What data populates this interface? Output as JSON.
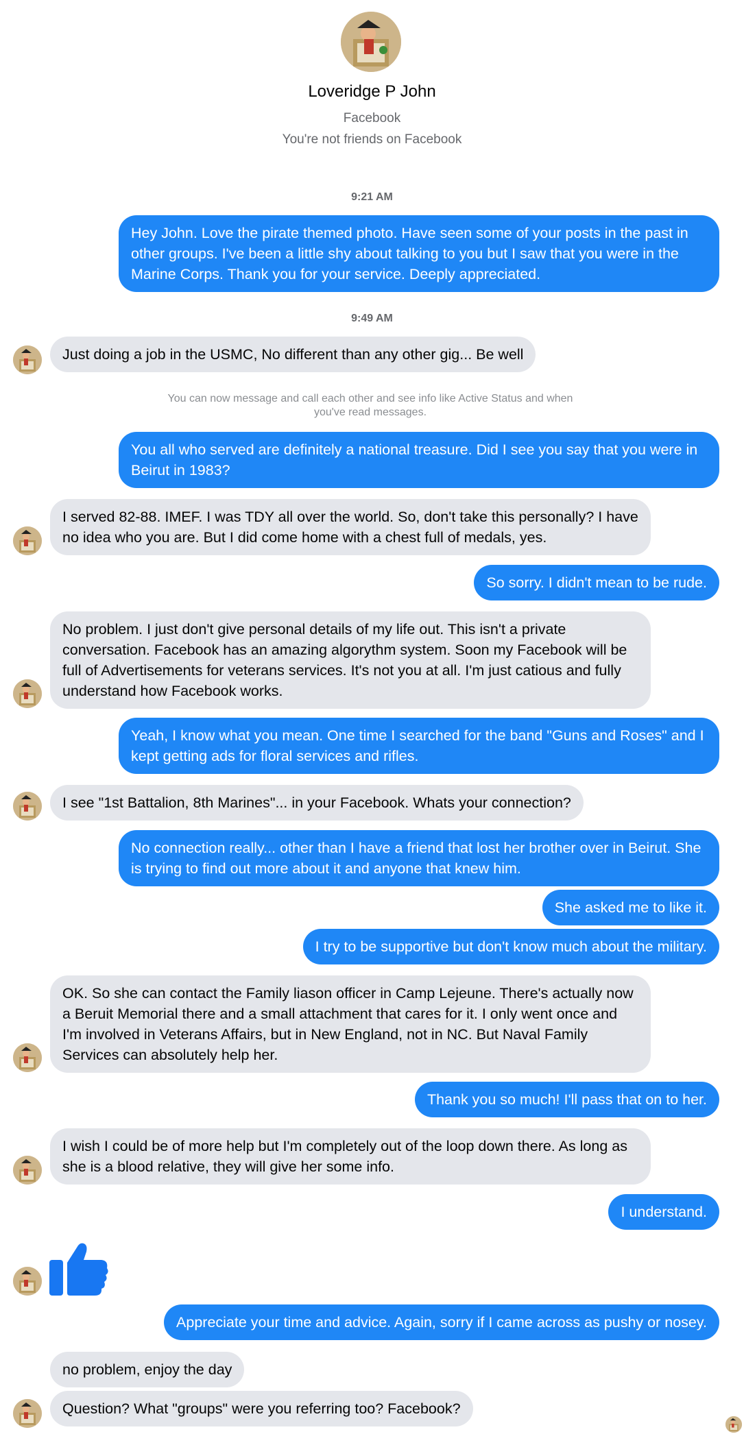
{
  "contact": {
    "name": "Loveridge P John",
    "platform": "Facebook",
    "relationship": "You're not friends on Facebook"
  },
  "timestamps": [
    "9:21 AM",
    "9:49 AM"
  ],
  "system_notice": "You can now message and call each other and see info like Active Status and when you've read messages.",
  "messages": [
    {
      "from": "me",
      "text": "Hey John.  Love the pirate themed photo.  Have seen some of your posts in the past in other groups.  I've been a little shy about talking to you but I saw that you were in the Marine Corps.  Thank you for your service.  Deeply appreciated."
    },
    {
      "from": "them",
      "text": "Just doing a job in the USMC, No different than any other gig... Be well"
    },
    {
      "from": "me",
      "text": "You all who served are definitely a national treasure.  Did I see you say that you were in Beirut in 1983?"
    },
    {
      "from": "them",
      "text": "I served 82-88. IMEF. I was TDY all over the world. So, don't take this personally? I have no idea who you are. But I did come home with a chest full of medals, yes."
    },
    {
      "from": "me",
      "text": "So sorry.  I didn't mean to be rude."
    },
    {
      "from": "them",
      "text": "No problem. I just don't give personal details of my life out. This isn't a private conversation. Facebook has an amazing algorythm system. Soon my Facebook will be full of Advertisements for veterans services. It's not you at all. I'm just catious and fully understand how Facebook works."
    },
    {
      "from": "me",
      "text": "Yeah, I know what you mean.  One time I searched for the band \"Guns and Roses\" and I kept getting ads for floral services and rifles."
    },
    {
      "from": "them",
      "text": "I see \"1st Battalion, 8th Marines\"... in your Facebook. Whats your connection?"
    },
    {
      "from": "me",
      "text": "No connection really... other than I have a friend that lost her brother over in Beirut.  She is trying to find out more about it and anyone that knew him."
    },
    {
      "from": "me",
      "text": "She asked me to like it."
    },
    {
      "from": "me",
      "text": "I try to be supportive but don't know much about the military."
    },
    {
      "from": "them",
      "text": "OK. So she can contact the Family liason officer in Camp Lejeune. There's actually now a Beruit Memorial there and a small attachment that cares for it. I only went once and I'm involved in Veterans Affairs, but in New England, not in NC. But Naval Family Services can absolutely help her."
    },
    {
      "from": "me",
      "text": "Thank you so much!  I'll pass that on to her."
    },
    {
      "from": "them",
      "text": "I wish I could be of more help but I'm completely out of the loop down there. As long as she is a blood relative, they will give her some info."
    },
    {
      "from": "me",
      "text": "I understand."
    },
    {
      "from": "me",
      "text": "Appreciate your time and advice.  Again, sorry if I came across as pushy or nosey."
    },
    {
      "from": "them",
      "text": "no problem, enjoy the day"
    },
    {
      "from": "them",
      "text": "Question? What \"groups\" were you referring too? Facebook?"
    }
  ],
  "colors": {
    "outgoing_bubble": "#1f87f6",
    "incoming_bubble": "#e4e6eb",
    "like_icon": "#1877f2"
  },
  "icons": [
    "contact-avatar",
    "like-thumbs-up-icon"
  ]
}
